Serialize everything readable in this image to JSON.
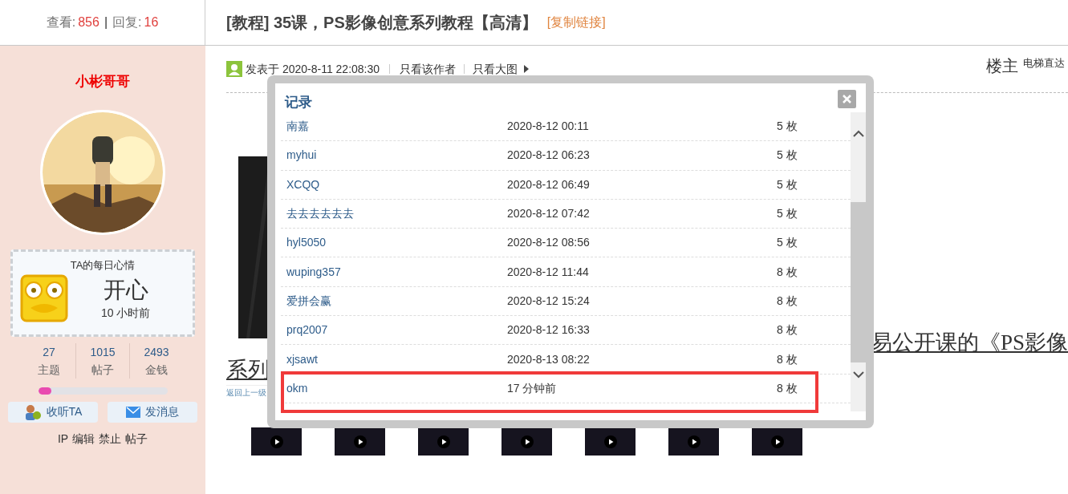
{
  "header": {
    "views_label": "查看:",
    "views": "856",
    "separator": "|",
    "replies_label": "回复:",
    "replies": "16",
    "title": "[教程] 35课，PS影像创意系列教程【高清】",
    "copy_link": "[复制链接]"
  },
  "author": {
    "name": "小彬哥哥",
    "mood": {
      "heading": "TA的每日心情",
      "mood": "开心",
      "time": "10 小时前"
    },
    "stats": [
      {
        "value": "27",
        "label": "主题"
      },
      {
        "value": "1015",
        "label": "帖子"
      },
      {
        "value": "2493",
        "label": "金钱"
      }
    ],
    "progress": {
      "level": 0.1
    },
    "buttons": [
      {
        "label": "收听TA",
        "kind": "follow"
      },
      {
        "label": "发消息",
        "kind": "message"
      }
    ],
    "admin_links": [
      "IP",
      "编辑",
      "禁止",
      "帖子"
    ]
  },
  "post": {
    "posted": "发表于 2020-8-11 22:08:30",
    "author_only": "只看该作者",
    "large_images": "只看大图",
    "floor": "楼主",
    "jump": "电梯直达",
    "text_line_1": "易公开课的《PS影像",
    "text_line_2": "系列",
    "back_link": "返回上一级",
    "videos": [
      {
        "kind": "video"
      },
      {
        "kind": "video"
      },
      {
        "kind": "video"
      },
      {
        "kind": "video"
      },
      {
        "kind": "video"
      },
      {
        "kind": "video"
      },
      {
        "kind": "video"
      }
    ]
  },
  "dialog": {
    "title": "记录",
    "rows": [
      {
        "name": "南嘉",
        "time": "2020-8-12 00:11",
        "amount": "5 枚",
        "highlighted": false
      },
      {
        "name": "myhui",
        "time": "2020-8-12 06:23",
        "amount": "5 枚",
        "highlighted": false
      },
      {
        "name": "XCQQ",
        "time": "2020-8-12 06:49",
        "amount": "5 枚",
        "highlighted": false
      },
      {
        "name": "去去去去去去",
        "time": "2020-8-12 07:42",
        "amount": "5 枚",
        "highlighted": false
      },
      {
        "name": "hyl5050",
        "time": "2020-8-12 08:56",
        "amount": "5 枚",
        "highlighted": false
      },
      {
        "name": "wuping357",
        "time": "2020-8-12 11:44",
        "amount": "8 枚",
        "highlighted": false
      },
      {
        "name": "爱拼会赢",
        "time": "2020-8-12 15:24",
        "amount": "8 枚",
        "highlighted": false
      },
      {
        "name": "prq2007",
        "time": "2020-8-12 16:33",
        "amount": "8 枚",
        "highlighted": false
      },
      {
        "name": "xjsawt",
        "time": "2020-8-13 08:22",
        "amount": "8 枚",
        "highlighted": false
      },
      {
        "name": "okm",
        "time": "17 分钟前",
        "amount": "8 枚",
        "highlighted": true
      }
    ]
  }
}
